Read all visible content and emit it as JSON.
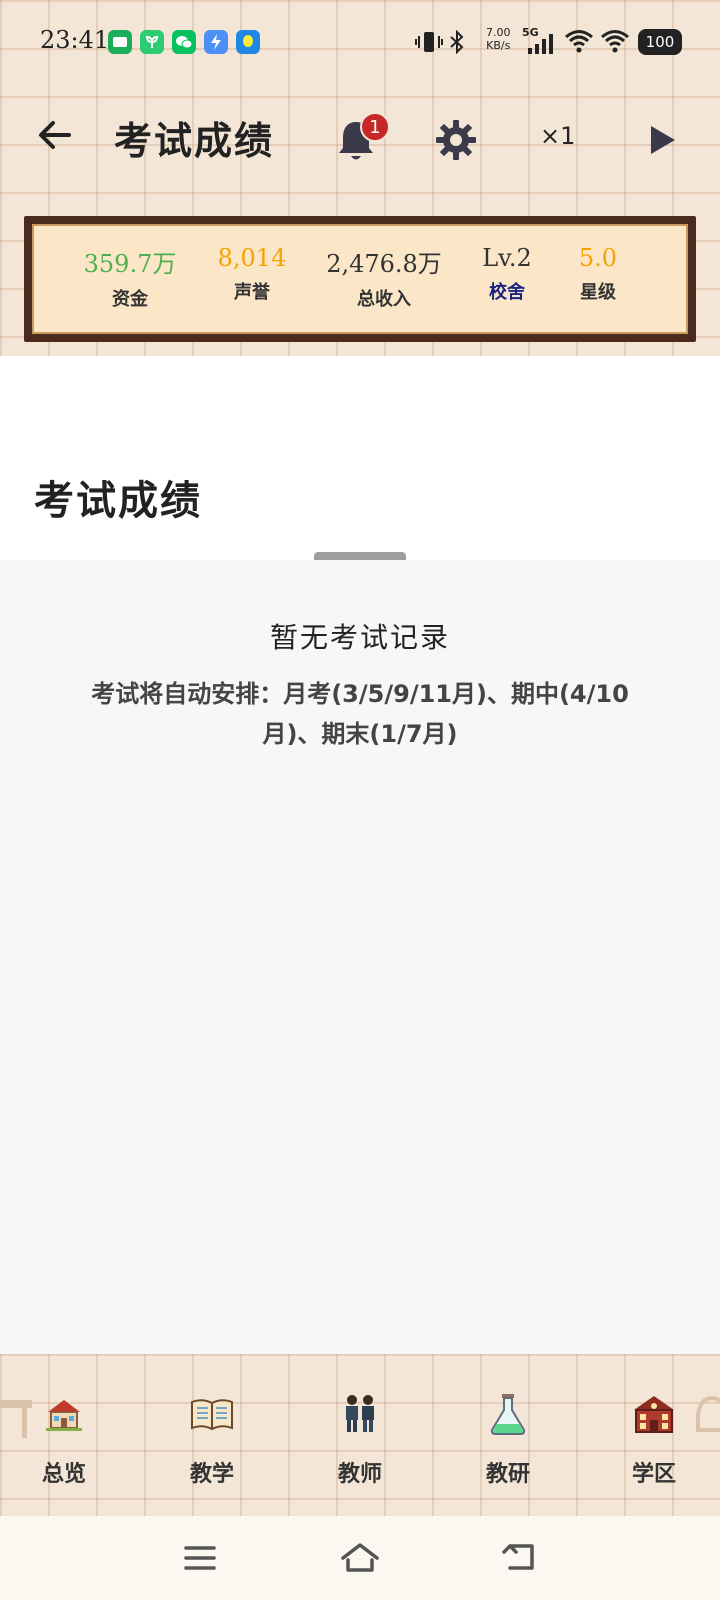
{
  "status_bar": {
    "time": "23:41",
    "net_speed_value": "7.00",
    "net_speed_unit": "KB/s",
    "network": "5G",
    "battery": "100"
  },
  "header": {
    "title": "考试成绩",
    "notification_count": "1",
    "speed": "×1"
  },
  "stats": [
    {
      "value": "359.7万",
      "label": "资金",
      "value_color": "#4caf50",
      "label_color": "#333333"
    },
    {
      "value": "8,014",
      "label": "声誉",
      "value_color": "#f5a300",
      "label_color": "#333333"
    },
    {
      "value": "2,476.8万",
      "label": "总收入",
      "value_color": "#333333",
      "label_color": "#333333"
    },
    {
      "value": "Lv.2",
      "label": "校舍",
      "value_color": "#333333",
      "label_color": "#1a237e"
    },
    {
      "value": "5.0",
      "label": "星级",
      "value_color": "#f5a300",
      "label_color": "#333333"
    }
  ],
  "section": {
    "title": "考试成绩"
  },
  "empty_state": {
    "title": "暂无考试记录",
    "description": "考试将自动安排：月考(3/5/9/11月)、期中(4/10月)、期末(1/7月)"
  },
  "bottom_nav": [
    {
      "label": "总览",
      "icon": "school-house-icon"
    },
    {
      "label": "教学",
      "icon": "book-icon"
    },
    {
      "label": "教师",
      "icon": "teachers-icon"
    },
    {
      "label": "教研",
      "icon": "flask-icon"
    },
    {
      "label": "学区",
      "icon": "school-building-icon"
    }
  ]
}
